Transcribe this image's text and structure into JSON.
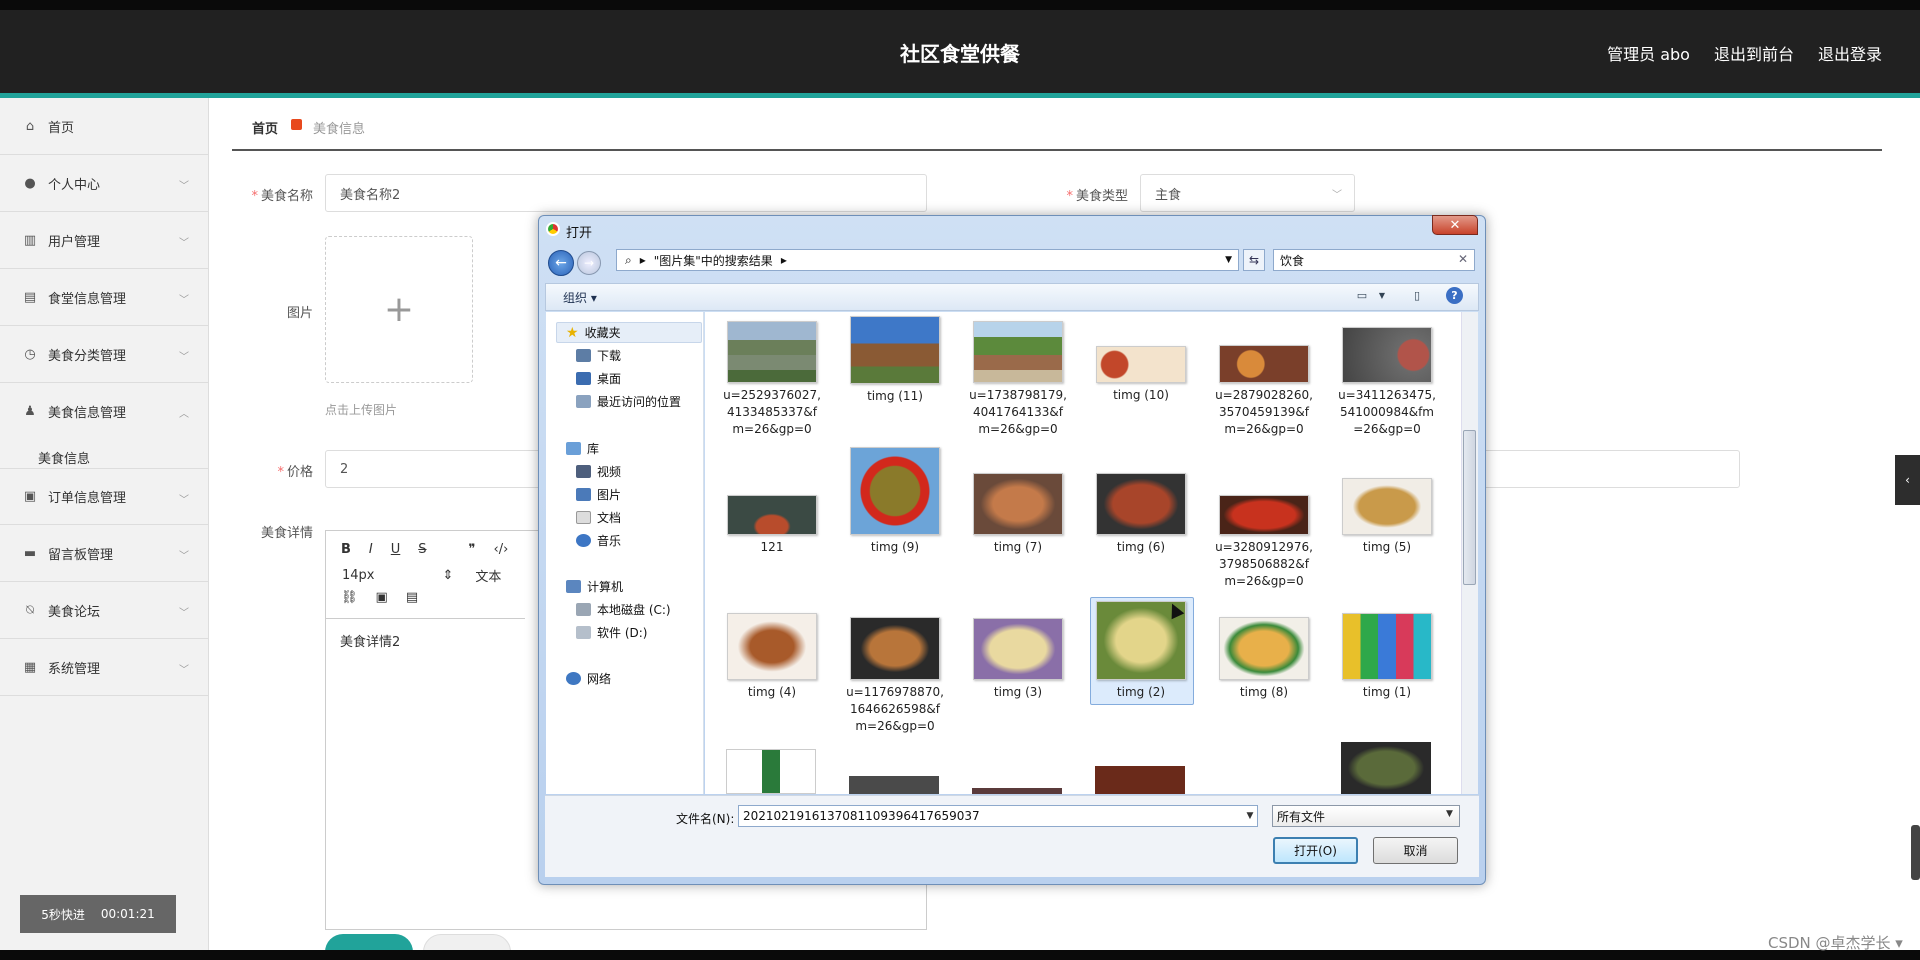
{
  "app": {
    "title": "社区食堂供餐",
    "links": [
      "管理员 abo",
      "退出到前台",
      "退出登录"
    ]
  },
  "sidebar": {
    "items": [
      {
        "label": "首页",
        "icon": "home-icon"
      },
      {
        "label": "个人中心",
        "icon": "user-icon"
      },
      {
        "label": "用户管理",
        "icon": "chart-icon"
      },
      {
        "label": "食堂信息管理",
        "icon": "briefcase-icon"
      },
      {
        "label": "美食分类管理",
        "icon": "clock-icon"
      },
      {
        "label": "美食信息管理",
        "icon": "person-icon"
      },
      {
        "label": "订单信息管理",
        "icon": "clipboard-icon"
      },
      {
        "label": "留言板管理",
        "icon": "sign-icon"
      },
      {
        "label": "美食论坛",
        "icon": "bell-off-icon"
      },
      {
        "label": "系统管理",
        "icon": "grid-icon"
      }
    ],
    "sub_item": "美食信息",
    "timer_label": "5秒快进",
    "timer_value": "00:01:21"
  },
  "breadcrumb": {
    "home": "首页",
    "current": "美食信息"
  },
  "form": {
    "name_label": "美食名称",
    "name_value": "美食名称2",
    "type_label": "美食类型",
    "type_value": "主食",
    "image_label": "图片",
    "upload_hint": "点击上传图片",
    "price_label": "价格",
    "price_value": "2",
    "detail_label": "美食详情",
    "font_size": "14px",
    "font_style": "文本",
    "detail_text": "美食详情2"
  },
  "dialog": {
    "title": "打开",
    "address": "\"图片集\"中的搜索结果",
    "search_value": "饮食",
    "organize": "组织 ▾",
    "nav": {
      "favorites": "收藏夹",
      "favorites_items": [
        "下载",
        "桌面",
        "最近访问的位置"
      ],
      "library": "库",
      "library_items": [
        "视频",
        "图片",
        "文档",
        "音乐"
      ],
      "computer": "计算机",
      "computer_items": [
        "本地磁盘 (C:)",
        "软件 (D:)"
      ],
      "network": "网络"
    },
    "files": [
      "u=2529376027,4133485337&fm=26&gp=0",
      "timg (11)",
      "u=1738798179,4041764133&fm=26&gp=0",
      "timg (10)",
      "u=2879028260,3570459139&fm=26&gp=0",
      "u=3411263475,541000984&fm=26&gp=0",
      "121",
      "timg (9)",
      "timg (7)",
      "timg (6)",
      "u=3280912976,3798506882&fm=26&gp=0",
      "timg (5)",
      "timg (4)",
      "u=1176978870,1646626598&fm=26&gp=0",
      "timg (3)",
      "timg (2)",
      "timg (8)",
      "timg (1)"
    ],
    "filename_label": "文件名(N):",
    "filename_value": "20210219161370811093964176590​37",
    "filetype": "所有文件",
    "open_button": "打开(O)",
    "cancel_button": "取消"
  },
  "watermark": "CSDN @卓杰学长 ▾"
}
